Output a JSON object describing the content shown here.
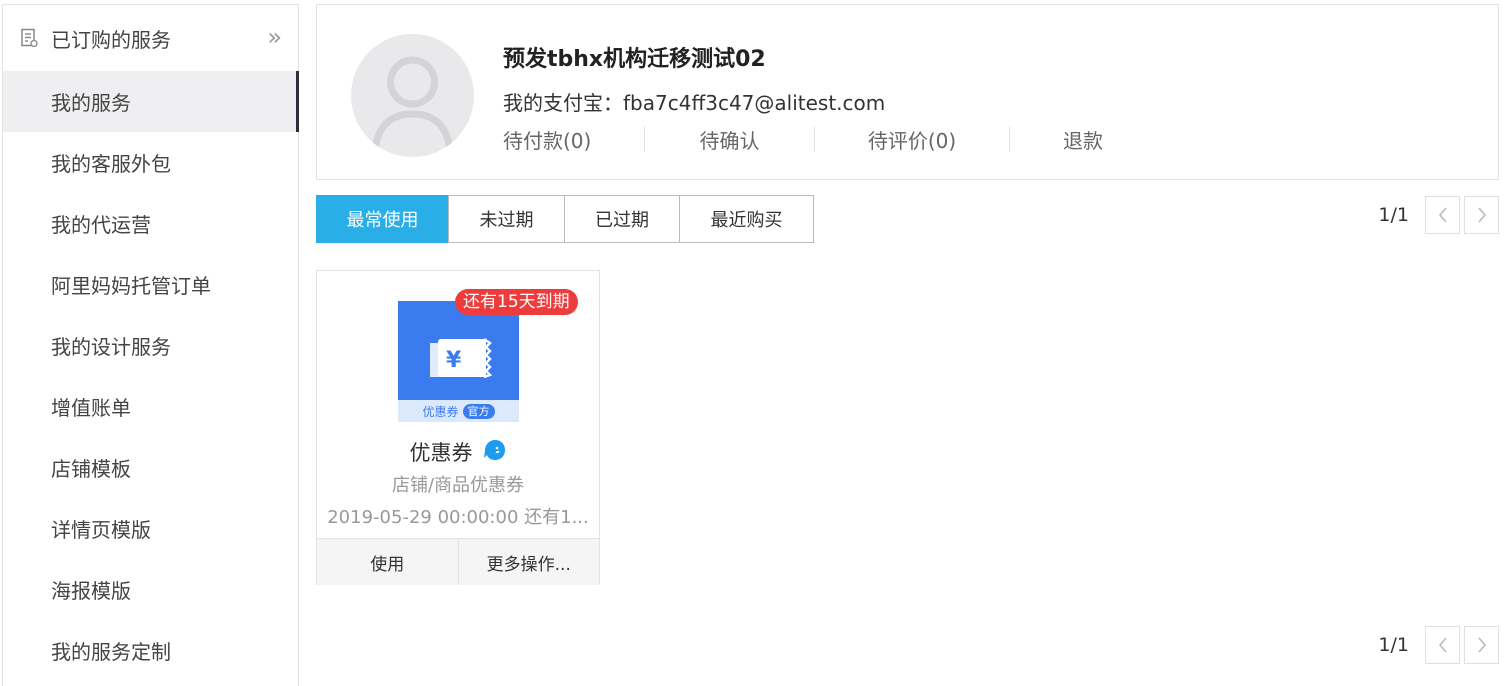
{
  "sidebar": {
    "header_title": "已订购的服务",
    "collapse_glyph": "»",
    "items": [
      {
        "label": "我的服务",
        "active": true
      },
      {
        "label": "我的客服外包"
      },
      {
        "label": "我的代运营"
      },
      {
        "label": "阿里妈妈托管订单"
      },
      {
        "label": "我的设计服务"
      },
      {
        "label": "增值账单"
      },
      {
        "label": "店铺模板"
      },
      {
        "label": "详情页模版"
      },
      {
        "label": "海报模版"
      },
      {
        "label": "我的服务定制"
      }
    ]
  },
  "profile": {
    "shop_name": "预发tbhx机构迁移测试02",
    "alipay_label": "我的支付宝：",
    "alipay_account": "fba7c4ff3c47@alitest.com",
    "statuses": [
      {
        "label": "待付款(0)"
      },
      {
        "label": "待确认"
      },
      {
        "label": "待评价(0)"
      },
      {
        "label": "退款"
      }
    ]
  },
  "tabs": [
    {
      "label": "最常使用",
      "active": true
    },
    {
      "label": "未过期"
    },
    {
      "label": "已过期"
    },
    {
      "label": "最近购买"
    }
  ],
  "pager_top": {
    "text": "1/1"
  },
  "pager_bottom": {
    "text": "1/1"
  },
  "card": {
    "badge": "还有15天到期",
    "thumb_label": "优惠券",
    "thumb_tag": "官方",
    "thumb_symbol": "¥",
    "name": "优惠券",
    "subtitle": "店铺/商品优惠券",
    "date": "2019-05-29 00:00:00 还有1...",
    "use_label": "使用",
    "more_label": "更多操作..."
  },
  "colors": {
    "accent": "#29aee8",
    "badge": "#ee3b3b",
    "coupon_blue": "#3a7cf0",
    "sidebar_active": "#efeff1"
  },
  "icons": {
    "sidebar_header": "document-icon",
    "collapse": "double-chevron-right-icon",
    "avatar": "user-avatar-placeholder-icon",
    "coupon": "coupon-ticket-icon",
    "chat": "chat-bubble-icon",
    "prev": "chevron-left-icon",
    "next": "chevron-right-icon"
  }
}
